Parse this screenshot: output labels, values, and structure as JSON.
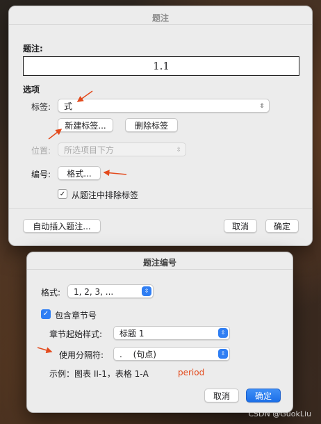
{
  "caption_dialog": {
    "title": "题注",
    "caption_heading": "题注:",
    "caption_value": "1.1",
    "options_heading": "选项",
    "label_label": "标签:",
    "label_value": "式",
    "new_label_button": "新建标签...",
    "delete_label_button": "删除标签",
    "position_label": "位置:",
    "position_value": "所选项目下方",
    "numbering_label": "编号:",
    "format_button": "格式...",
    "exclude_label_checkbox": "从题注中排除标签",
    "exclude_label_checked": true,
    "auto_caption_button": "自动插入题注...",
    "cancel_button": "取消",
    "ok_button": "确定"
  },
  "numbering_dialog": {
    "title": "题注编号",
    "format_label": "格式:",
    "format_value": "1, 2, 3, ...",
    "include_chapter_checkbox": "包含章节号",
    "include_chapter_checked": true,
    "chapter_style_label": "章节起始样式:",
    "chapter_style_value": "标题 1",
    "separator_label": "使用分隔符:",
    "separator_value": ".　  (句点)",
    "example_text": "示例：图表 II-1，表格 1-A",
    "annotation_text": "period",
    "cancel_button": "取消",
    "ok_button": "确定"
  },
  "watermark": "CSDN @GuokLiu",
  "colors": {
    "accent": "#2f7ef3",
    "annotation": "#e34a1c",
    "dialog_bg": "#ececec"
  },
  "icons": [
    "chevron-updown-icon",
    "checkmark-icon",
    "arrow-annotation-icon"
  ]
}
